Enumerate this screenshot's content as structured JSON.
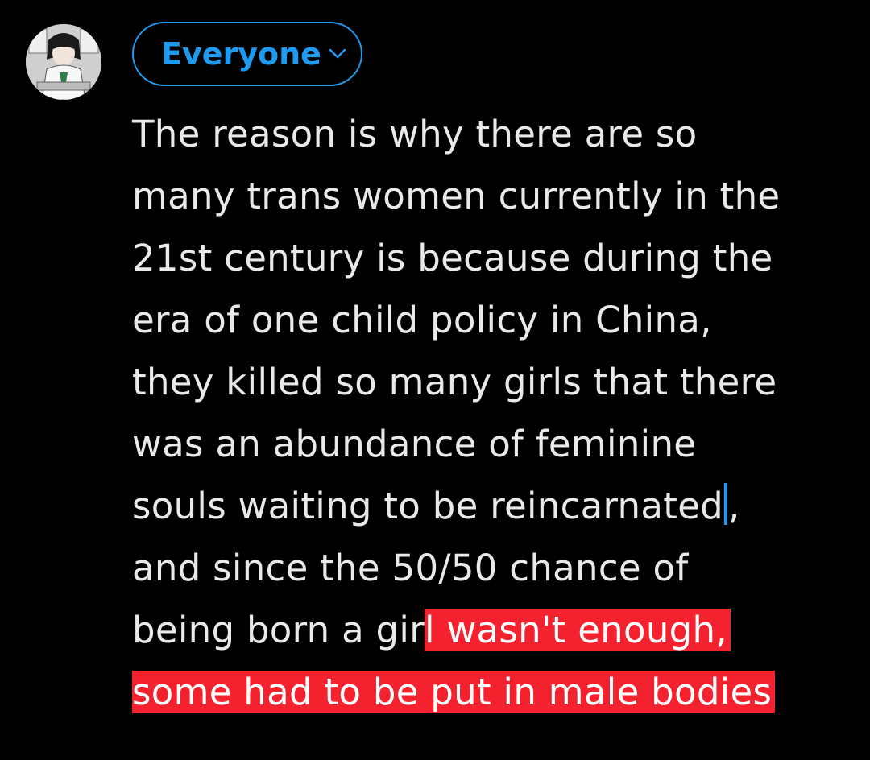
{
  "composer": {
    "audience_label": "Everyone",
    "text_lines": [
      "The reason is why there are so",
      "many trans women currently in the",
      "21st century is because during the",
      "era of one child policy in China,",
      "they killed so many girls that there",
      "was an abundance of feminine",
      "souls waiting to be reincarnated",
      ",",
      "and since the 50/50 chance of",
      "being born a gir",
      "l wasn't enough,",
      "some had to be put in male bodies"
    ]
  },
  "colors": {
    "accent": "#1d9bf0",
    "highlight": "#f4212e",
    "text": "#e7e9ea",
    "background": "#000000"
  },
  "icons": {
    "audience_chevron": "chevron-down-icon",
    "avatar": "user-avatar"
  }
}
